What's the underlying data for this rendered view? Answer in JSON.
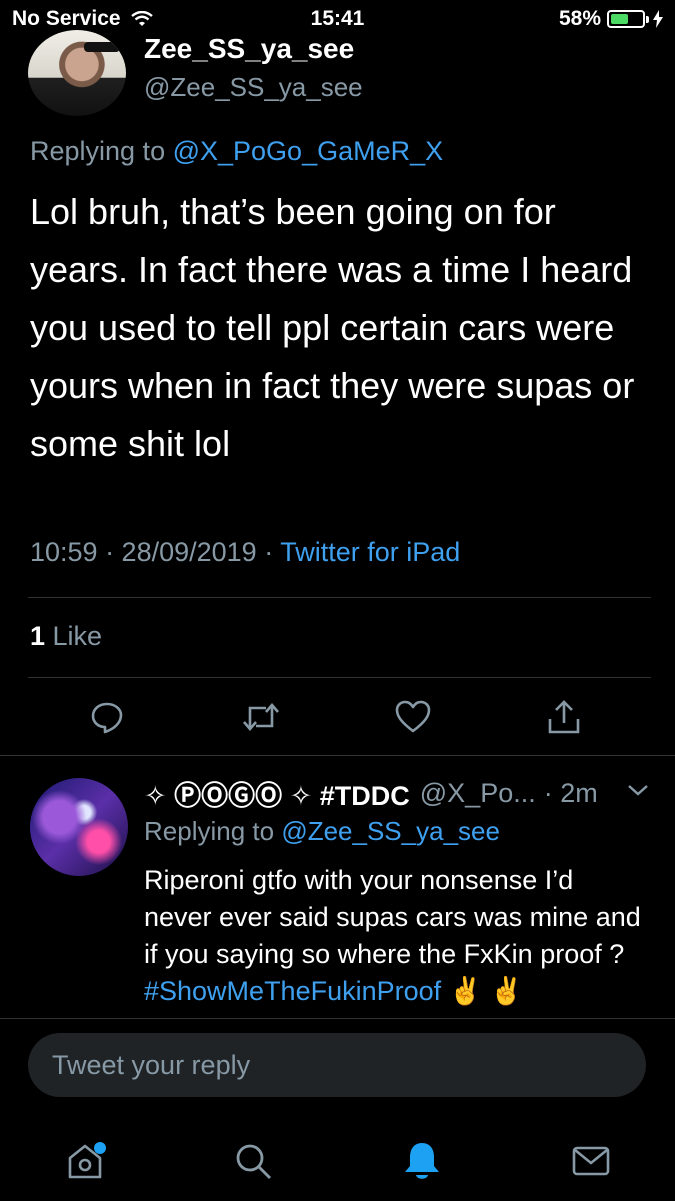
{
  "status_bar": {
    "carrier": "No Service",
    "time": "15:41",
    "battery": "58%",
    "battery_level": 0.58
  },
  "tweet": {
    "name": "Zee_SS_ya_see",
    "handle": "@Zee_SS_ya_see",
    "replying_prefix": "Replying to ",
    "replying_to": "@X_PoGo_GaMeR_X",
    "text": "Lol bruh, that’s been going on for years. In fact there was a time I heard you used to tell ppl certain cars were yours when in fact they were supas or some shit lol",
    "timestamp": "10:59 · 28/09/2019 · ",
    "source": "Twitter for iPad",
    "like_count": "1",
    "like_label": " Like",
    "actions": [
      "reply-icon",
      "retweet-icon",
      "like-icon",
      "share-icon"
    ]
  },
  "reply": {
    "name": "✧ ⓅⓄⒼⓄ ✧ #TDDC",
    "handle": "@X_Po...",
    "time": "· 2m",
    "replying_prefix": "Replying to ",
    "replying_to": "@Zee_SS_ya_see",
    "text": "Riperoni gtfo with your nonsense I’d never ever said supas cars was mine and if you saying so where the FxKin proof ?  ",
    "hashtag": "#ShowMeTheFukinProof",
    "emoji": " ✌️ ✌️"
  },
  "composer": {
    "placeholder": "Tweet your reply"
  },
  "tabs": [
    "home-icon",
    "search-icon",
    "notifications-icon",
    "messages-icon"
  ],
  "colors": {
    "accent": "#1da1f2",
    "link": "#3ea0ef",
    "muted": "#8899a6",
    "background": "#000000"
  }
}
